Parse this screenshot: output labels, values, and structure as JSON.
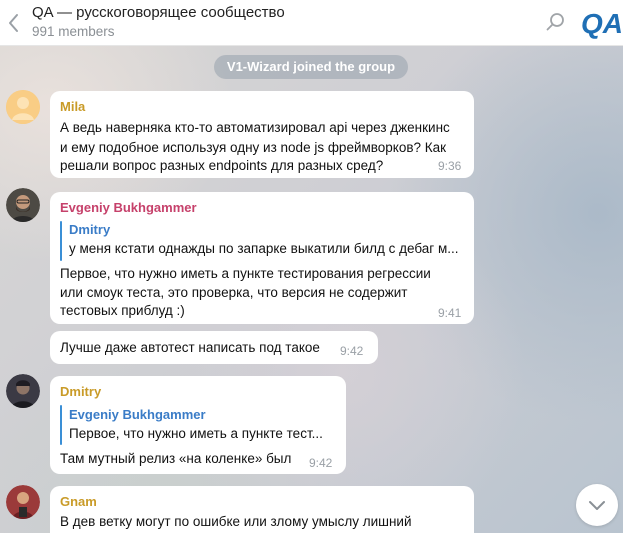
{
  "header": {
    "title": "QA — русскоговорящее сообщество",
    "subtitle": "991 members",
    "logo_text": "QA"
  },
  "service_message": "V1-Wizard joined the group",
  "messages": [
    {
      "sender": "Mila",
      "sender_color": "#c99b28",
      "lines": [
        "А ведь наверняка кто-то автоматизировал api через дженкинс",
        "и ему подобное используя одну из node js фреймворков? Как",
        "решали вопрос разных endpoints для разных сред?"
      ],
      "time": "9:36"
    },
    {
      "sender": "Evgeniy Bukhgammer",
      "sender_color": "#c6416b",
      "reply": {
        "name": "Dmitry",
        "text": "у меня кстати однажды по запарке выкатили билд с дебаг м..."
      },
      "lines": [
        "Первое, что нужно иметь а пункте тестирования регрессии",
        "или смоук теста, это проверка, что версия не содержит",
        "тестовых приблуд :)"
      ],
      "time": "9:41"
    },
    {
      "sender": "",
      "lines": [
        "Лучше даже автотест написать под такое"
      ],
      "time": "9:42"
    },
    {
      "sender": "Dmitry",
      "sender_color": "#c99b28",
      "reply": {
        "name": "Evgeniy Bukhgammer",
        "text": "Первое, что нужно иметь а пункте тест..."
      },
      "lines": [
        "Там мутный релиз «на коленке» был"
      ],
      "time": "9:42"
    },
    {
      "sender": "Gnam",
      "sender_color": "#c99b28",
      "lines": [
        "В дев ветку могут по ошибке или злому умыслу лишний"
      ],
      "time": ""
    }
  ]
}
